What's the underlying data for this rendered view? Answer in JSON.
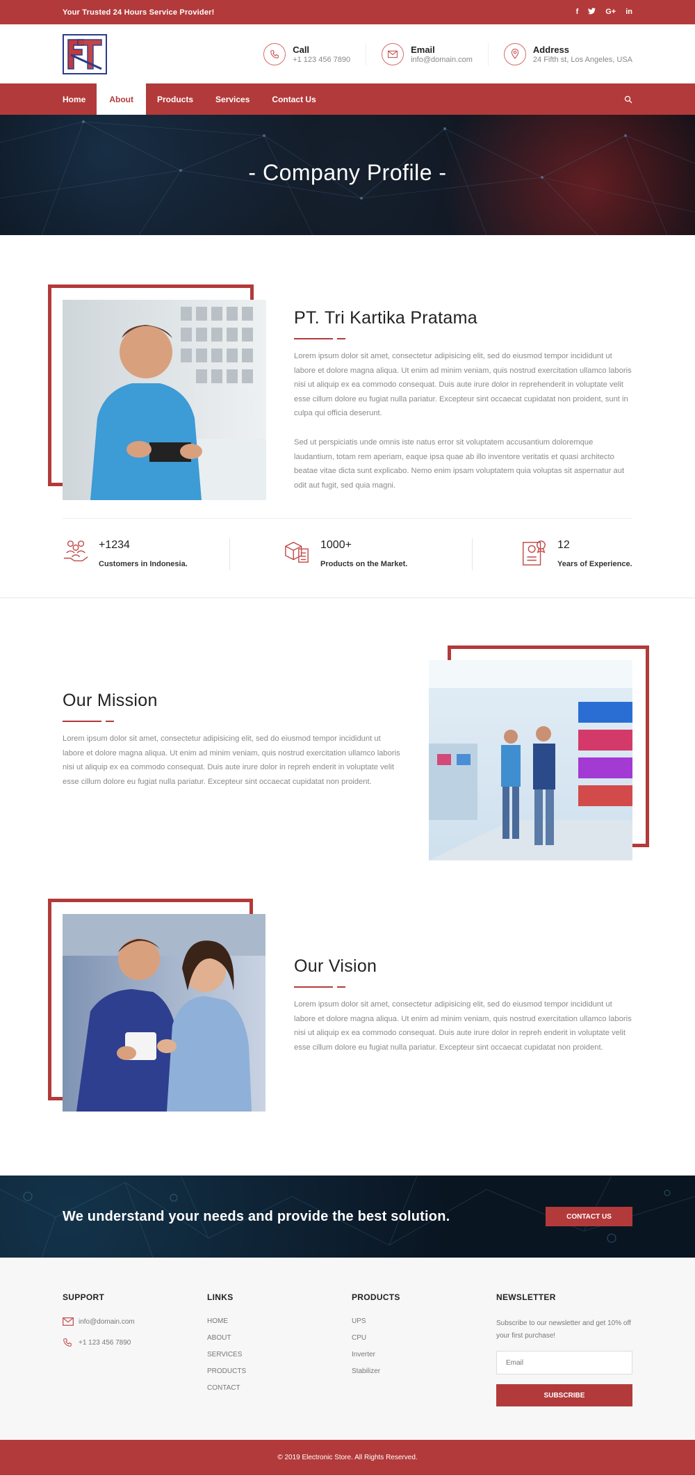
{
  "topbar": {
    "tagline": "Your Trusted 24 Hours Service Provider!",
    "social": [
      "f",
      "t",
      "G+",
      "in"
    ]
  },
  "header": {
    "contacts": [
      {
        "title": "Call",
        "value": "+1 123 456 7890",
        "icon": "phone-icon"
      },
      {
        "title": "Email",
        "value": "info@domain.com",
        "icon": "mail-icon"
      },
      {
        "title": "Address",
        "value": "24 Fifth st, Los Angeles, USA",
        "icon": "map-pin-icon"
      }
    ]
  },
  "nav": {
    "items": [
      "Home",
      "About",
      "Products",
      "Services",
      "Contact Us"
    ],
    "active": "About"
  },
  "hero": {
    "title": "- Company Profile -"
  },
  "profile": {
    "title": "PT. Tri Kartika Pratama",
    "para1": "Lorem ipsum dolor sit amet, consectetur adipisicing elit, sed do eiusmod tempor incididunt ut labore et dolore magna aliqua. Ut enim ad minim veniam, quis nostrud exercitation ullamco laboris nisi ut aliquip ex ea commodo consequat. Duis aute irure dolor in reprehenderit in voluptate velit esse cillum dolore eu fugiat nulla pariatur. Excepteur sint occaecat cupidatat non proident, sunt in culpa qui officia deserunt.",
    "para2": "Sed ut perspiciatis unde omnis iste natus error sit voluptatem accusantium doloremque laudantium, totam rem aperiam, eaque ipsa quae ab illo inventore veritatis et quasi architecto beatae vitae dicta sunt explicabo. Nemo enim ipsam voluptatem quia voluptas sit aspernatur aut odit aut fugit, sed quia magni.",
    "stats": [
      {
        "number": "+1234",
        "label": "Customers in Indonesia."
      },
      {
        "number": "1000+",
        "label": "Products on the Market."
      },
      {
        "number": "12",
        "label": "Years of Experience."
      }
    ]
  },
  "mission": {
    "title": "Our Mission",
    "text": "Lorem ipsum dolor sit amet, consectetur adipisicing elit, sed do eiusmod tempor incididunt ut labore et dolore magna aliqua. Ut enim ad minim veniam, quis nostrud exercitation ullamco laboris nisi ut aliquip ex ea commodo consequat. Duis aute irure dolor in repreh enderit in voluptate velit esse cillum dolore eu fugiat nulla pariatur. Excepteur sint occaecat cupidatat non proident."
  },
  "vision": {
    "title": "Our Vision",
    "text": "Lorem ipsum dolor sit amet, consectetur adipisicing elit, sed do eiusmod tempor incididunt ut labore et dolore magna aliqua. Ut enim ad minim veniam, quis nostrud exercitation ullamco laboris nisi ut aliquip ex ea commodo consequat. Duis aute irure dolor in repreh enderit in voluptate velit esse cillum dolore eu fugiat nulla pariatur. Excepteur sint occaecat cupidatat non proident."
  },
  "cta": {
    "text": "We understand your needs and provide the best solution.",
    "button": "CONTACT US"
  },
  "footer": {
    "support": {
      "title": "SUPPORT",
      "email": "info@domain.com",
      "phone": "+1 123 456 7890"
    },
    "links": {
      "title": "LINKS",
      "items": [
        "HOME",
        "ABOUT",
        "SERVICES",
        "PRODUCTS",
        "CONTACT"
      ]
    },
    "products": {
      "title": "PRODUCTS",
      "items": [
        "UPS",
        "CPU",
        "Inverter",
        "Stabilizer"
      ]
    },
    "newsletter": {
      "title": "NEWSLETTER",
      "text": "Subscribe to our newsletter and get 10% off your first purchase!",
      "placeholder": "Email",
      "button": "SUBSCRIBE"
    }
  },
  "copyright": "© 2019 Electronic Store. All Rights Reserved.",
  "colors": {
    "brand": "#b33a3a",
    "dark": "#0a1522"
  }
}
